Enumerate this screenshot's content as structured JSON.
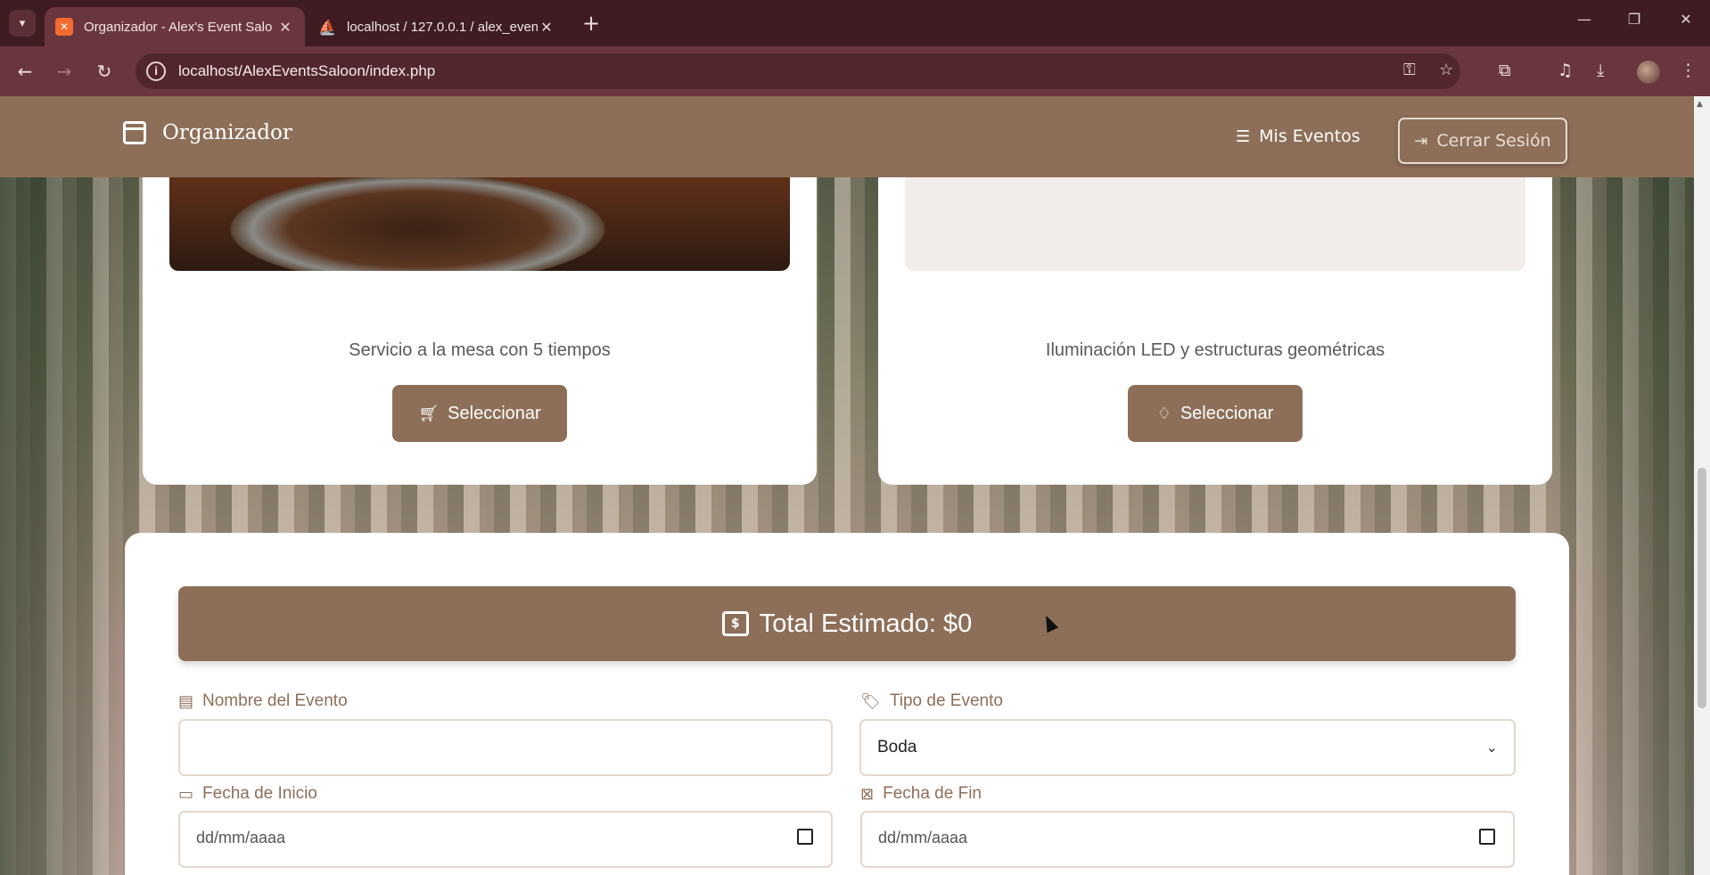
{
  "browser": {
    "tabs": [
      {
        "title": "Organizador - Alex's Event Salo",
        "favicon": "xampp-icon"
      },
      {
        "title": "localhost / 127.0.0.1 / alex_even",
        "favicon": "phpmyadmin-icon"
      }
    ],
    "url": "localhost/AlexEventsSaloon/index.php"
  },
  "navbar": {
    "brand": "Organizador",
    "mis_eventos": "Mis Eventos",
    "cerrar_sesion": "Cerrar Sesión"
  },
  "cards": [
    {
      "description": "Servicio a la mesa con 5 tiempos",
      "button": "Seleccionar",
      "icon": "cart-icon"
    },
    {
      "description": "Iluminación LED y estructuras geométricas",
      "button": "Seleccionar",
      "icon": "gem-icon"
    }
  ],
  "form": {
    "total_label": "Total Estimado: $0",
    "nombre_label": "Nombre del Evento",
    "nombre_value": "",
    "tipo_label": "Tipo de Evento",
    "tipo_value": "Boda",
    "fecha_inicio_label": "Fecha de Inicio",
    "fecha_inicio_placeholder": "dd/mm/aaaa",
    "fecha_fin_label": "Fecha de Fin",
    "fecha_fin_placeholder": "dd/mm/aaaa"
  },
  "colors": {
    "brand": "#8d6f59",
    "browser_frame": "#6a363d"
  }
}
